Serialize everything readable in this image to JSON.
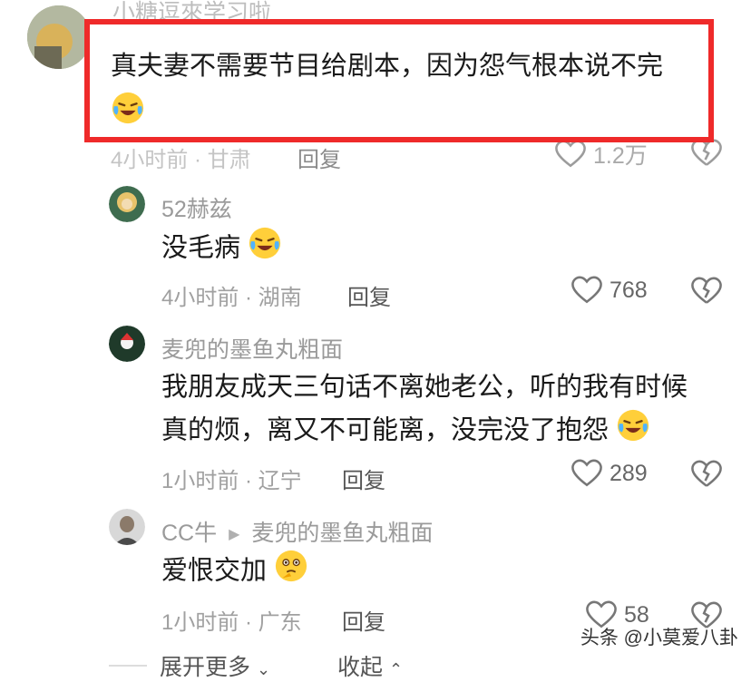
{
  "comments": [
    {
      "name": "小糖逗來学习啦",
      "text": "真夫妻不需要节目给剧本，因为怨气根本说不完",
      "meta": "4小时前 · 甘肃",
      "reply": "回复",
      "likes": "1.2万"
    },
    {
      "name": "52赫兹",
      "text": "没毛病",
      "meta": "4小时前 · 湖南",
      "reply": "回复",
      "likes": "768"
    },
    {
      "name": "麦兜的墨鱼丸粗面",
      "text_line1": "我朋友成天三句话不离她老公，听的我有时候",
      "text_line2": "真的烦，离又不可能离，没完没了抱怨",
      "meta": "1小时前 · 辽宁",
      "reply": "回复",
      "likes": "289"
    },
    {
      "name": "CC牛",
      "reply_to": "麦兜的墨鱼丸粗面",
      "text": "爱恨交加",
      "meta": "1小时前 · 广东",
      "reply": "回复",
      "likes": "58"
    }
  ],
  "footer": {
    "expand": "展开更多",
    "collapse": "收起"
  },
  "watermark": "头条 @小莫爱八卦",
  "colors": {
    "highlight_border": "#ef2a2a",
    "emoji_yellow": "#ffcf3a"
  }
}
